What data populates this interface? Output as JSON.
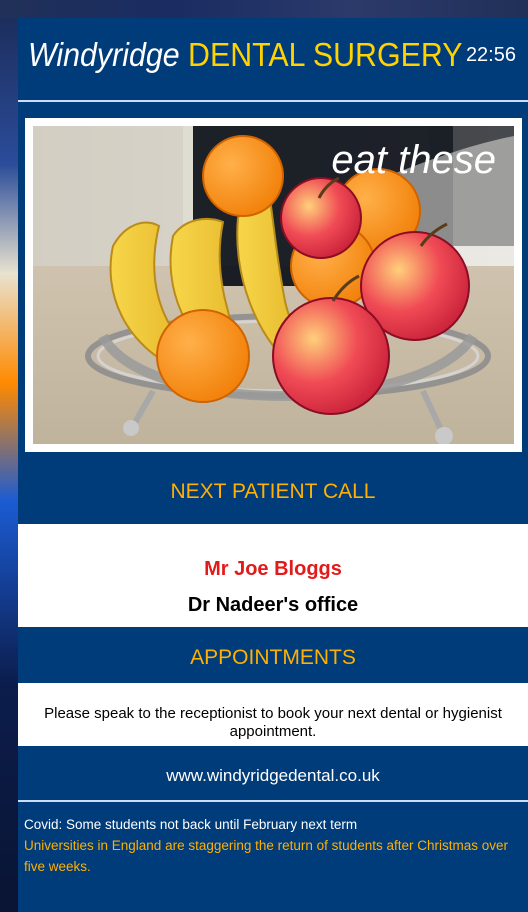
{
  "header": {
    "brand_italic": "Windyridge",
    "brand_caps": "DENTAL SURGERY",
    "clock": "22:56"
  },
  "hero": {
    "overlay": "eat these",
    "image_semantic": "fruit-bowl-photo"
  },
  "next_call": {
    "title": "NEXT PATIENT CALL",
    "patient_name": "Mr Joe Bloggs",
    "room": "Dr Nadeer's office"
  },
  "appointments": {
    "title": "APPOINTMENTS",
    "text": "Please speak to the receptionist to book your next dental or hygienist appointment."
  },
  "website": "www.windyridgedental.co.uk",
  "ticker": {
    "headline": "Covid: Some students not back until February next term",
    "detail": "Universities in England are staggering the return of students after Christmas over five weeks."
  },
  "colors": {
    "panel_blue": "#003b7a",
    "accent_yellow": "#ffd200",
    "accent_orange": "#ffb000",
    "name_red": "#e11b1b"
  }
}
